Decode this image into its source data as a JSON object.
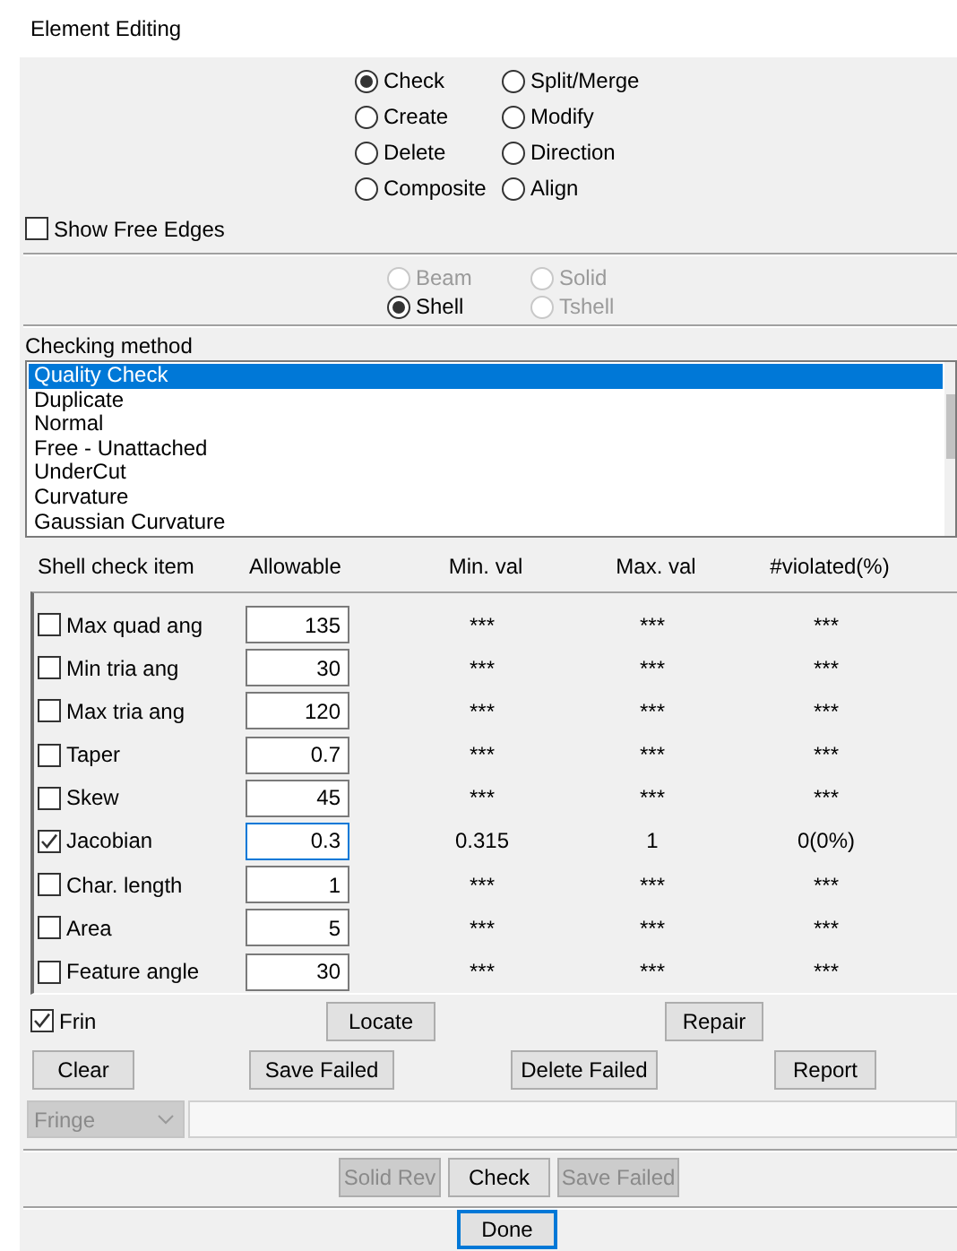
{
  "window": {
    "title": "Element Editing"
  },
  "operations": [
    {
      "label": "Check",
      "selected": true
    },
    {
      "label": "Split/Merge",
      "selected": false
    },
    {
      "label": "Create",
      "selected": false
    },
    {
      "label": "Modify",
      "selected": false
    },
    {
      "label": "Delete",
      "selected": false
    },
    {
      "label": "Direction",
      "selected": false
    },
    {
      "label": "Composite",
      "selected": false
    },
    {
      "label": "Align",
      "selected": false
    }
  ],
  "show_free_edges": {
    "label": "Show Free Edges",
    "checked": false
  },
  "element_types": [
    {
      "label": "Beam",
      "selected": false,
      "disabled": true
    },
    {
      "label": "Solid",
      "selected": false,
      "disabled": true
    },
    {
      "label": "Shell",
      "selected": true,
      "disabled": false
    },
    {
      "label": "Tshell",
      "selected": false,
      "disabled": true
    }
  ],
  "checking_method": {
    "label": "Checking method",
    "items": [
      {
        "label": "Quality Check",
        "selected": true
      },
      {
        "label": "Duplicate",
        "selected": false
      },
      {
        "label": "Normal",
        "selected": false
      },
      {
        "label": "Free - Unattached",
        "selected": false
      },
      {
        "label": "UnderCut",
        "selected": false
      },
      {
        "label": "Curvature",
        "selected": false
      },
      {
        "label": "Gaussian Curvature",
        "selected": false
      }
    ]
  },
  "check_table": {
    "columns": [
      "Shell check item",
      "Allowable",
      "Min. val",
      "Max. val",
      "#violated(%)"
    ],
    "rows": [
      {
        "label": "Max quad ang",
        "checked": false,
        "allowable": "135",
        "focused": false,
        "min": "***",
        "max": "***",
        "violated": "***"
      },
      {
        "label": "Min tria ang",
        "checked": false,
        "allowable": "30",
        "focused": false,
        "min": "***",
        "max": "***",
        "violated": "***"
      },
      {
        "label": "Max tria ang",
        "checked": false,
        "allowable": "120",
        "focused": false,
        "min": "***",
        "max": "***",
        "violated": "***"
      },
      {
        "label": "Taper",
        "checked": false,
        "allowable": "0.7",
        "focused": false,
        "min": "***",
        "max": "***",
        "violated": "***"
      },
      {
        "label": "Skew",
        "checked": false,
        "allowable": "45",
        "focused": false,
        "min": "***",
        "max": "***",
        "violated": "***"
      },
      {
        "label": "Jacobian",
        "checked": true,
        "allowable": "0.3",
        "focused": true,
        "min": "0.315",
        "max": "1",
        "violated": "0(0%)"
      },
      {
        "label": "Char. length",
        "checked": false,
        "allowable": "1",
        "focused": false,
        "min": "***",
        "max": "***",
        "violated": "***"
      },
      {
        "label": "Area",
        "checked": false,
        "allowable": "5",
        "focused": false,
        "min": "***",
        "max": "***",
        "violated": "***"
      },
      {
        "label": "Feature angle",
        "checked": false,
        "allowable": "30",
        "focused": false,
        "min": "***",
        "max": "***",
        "violated": "***"
      }
    ]
  },
  "fringe_checkbox": {
    "label": "Frin",
    "checked": true
  },
  "action_buttons": [
    {
      "label": "Locate"
    },
    {
      "label": "Repair"
    }
  ],
  "result_buttons": [
    {
      "label": "Clear"
    },
    {
      "label": "Save Failed"
    },
    {
      "label": "Delete Failed"
    },
    {
      "label": "Report"
    }
  ],
  "fringe_select": {
    "value": "Fringe",
    "disabled": true
  },
  "bottom_buttons": [
    {
      "label": "Solid Rev",
      "disabled": true
    },
    {
      "label": "Check",
      "disabled": false
    },
    {
      "label": "Save Failed",
      "disabled": true
    }
  ],
  "done_button": {
    "label": "Done",
    "focused": true
  }
}
